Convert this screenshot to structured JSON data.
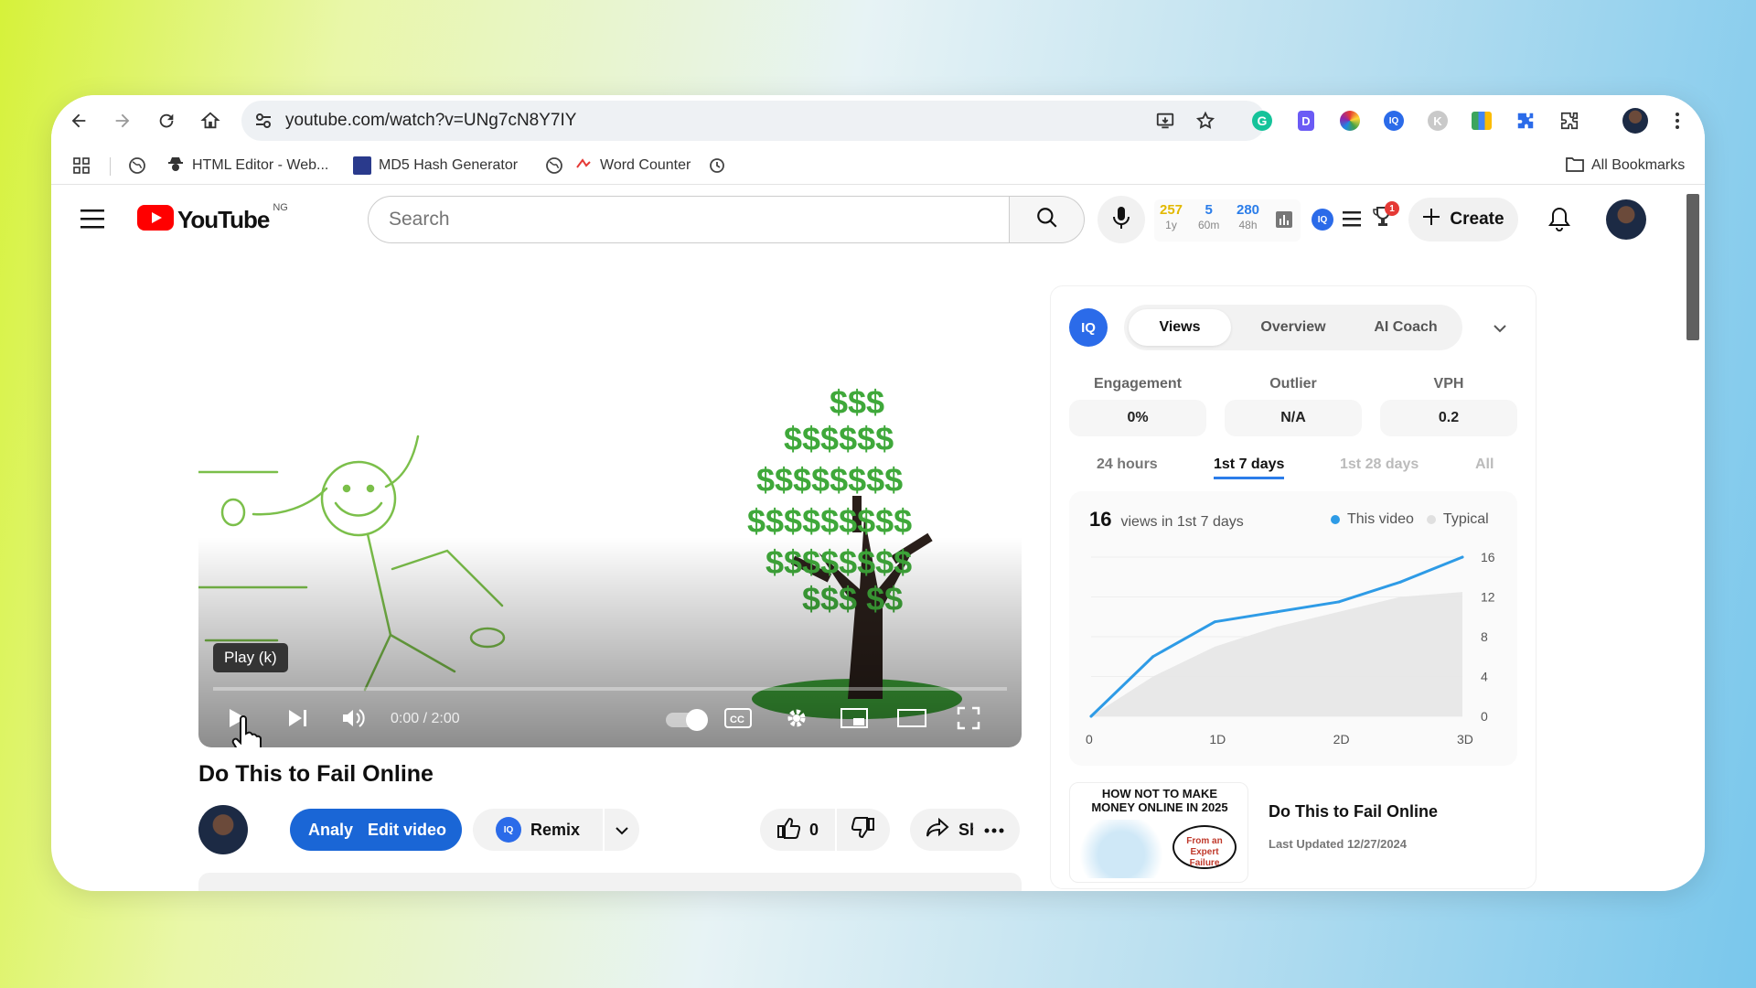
{
  "browser": {
    "url": "youtube.com/watch?v=UNg7cN8Y7IY",
    "bookmarks": [
      {
        "label": "HTML Editor - Web..."
      },
      {
        "label": "MD5 Hash Generator"
      },
      {
        "label": "Word Counter"
      }
    ],
    "all_bookmarks": "All Bookmarks"
  },
  "youtube": {
    "logo_text": "YouTube",
    "country": "NG",
    "search_placeholder": "Search",
    "create_label": "Create",
    "notification_badge": "1",
    "stats": [
      {
        "value": "257",
        "sub": "1y",
        "color": "#e2b800"
      },
      {
        "value": "5",
        "sub": "60m",
        "color": "#2b7de9"
      },
      {
        "value": "280",
        "sub": "48h",
        "color": "#2b7de9"
      }
    ]
  },
  "player": {
    "tooltip": "Play (k)",
    "time": "0:00 / 2:00",
    "progress": 0
  },
  "video": {
    "title": "Do This to Fail Online",
    "analytics_label": "Analy",
    "edit_label": "Edit video",
    "remix_label": "Remix",
    "like_count": "0",
    "share_label": "Share"
  },
  "panel": {
    "tabs": [
      {
        "label": "Views",
        "active": true
      },
      {
        "label": "Overview",
        "active": false
      },
      {
        "label": "AI Coach",
        "active": false
      }
    ],
    "metrics": [
      {
        "label": "Engagement",
        "value": "0%"
      },
      {
        "label": "Outlier",
        "value": "N/A"
      },
      {
        "label": "VPH",
        "value": "0.2"
      }
    ],
    "ranges": [
      {
        "label": "24 hours",
        "state": "normal"
      },
      {
        "label": "1st 7 days",
        "state": "active"
      },
      {
        "label": "1st 28 days",
        "state": "dim"
      },
      {
        "label": "All",
        "state": "dim"
      }
    ],
    "views_count": "16",
    "views_caption": "views in 1st 7 days",
    "legend_this": "This video",
    "legend_typical": "Typical",
    "thumb_text": "HOW NOT TO MAKE MONEY ONLINE IN 2025",
    "thumb_bubble": "From an Expert Failure",
    "card_title": "Do This to Fail Online",
    "card_updated": "Last Updated 12/27/2024"
  },
  "chart_data": {
    "type": "line",
    "x_ticks": [
      "0",
      "1D",
      "2D",
      "3D"
    ],
    "y_ticks": [
      16,
      12,
      8,
      4,
      0
    ],
    "ylim": [
      0,
      16
    ],
    "xlim": [
      0,
      3
    ],
    "series": [
      {
        "name": "This video",
        "color": "#2e9be6",
        "x": [
          0,
          0.5,
          1,
          1.5,
          2,
          2.5,
          3
        ],
        "y": [
          0,
          6,
          9.5,
          10.5,
          11.5,
          13.5,
          16
        ]
      },
      {
        "name": "Typical",
        "color": "#e6e6e6",
        "x": [
          0,
          0.5,
          1,
          1.5,
          2,
          2.5,
          3
        ],
        "y": [
          0,
          4,
          7,
          9,
          10.5,
          12,
          12.5
        ]
      }
    ],
    "legend_position": "top-right"
  }
}
